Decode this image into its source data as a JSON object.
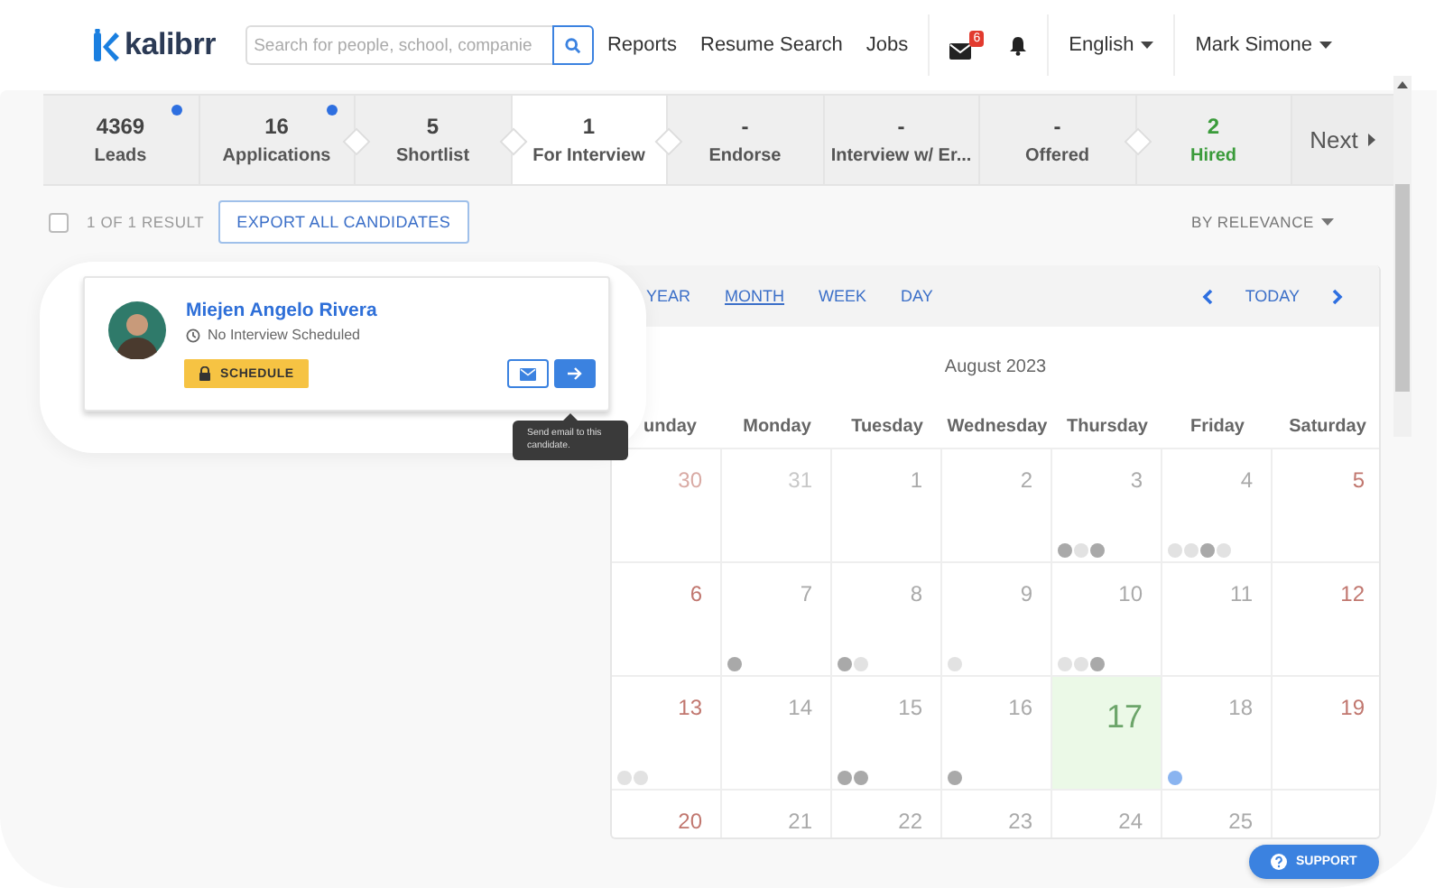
{
  "header": {
    "logo": "kalibrr",
    "search": {
      "placeholder": "Search for people, school, companie"
    },
    "nav": [
      "Reports",
      "Resume Search",
      "Jobs"
    ],
    "mail_badge": "6",
    "language": "English",
    "user": "Mark Simone"
  },
  "stages": [
    {
      "count": "4369",
      "label": "Leads",
      "notify": true,
      "selected": false,
      "kind": "stage",
      "arrow": false
    },
    {
      "count": "16",
      "label": "Applications",
      "notify": true,
      "selected": false,
      "kind": "stage",
      "arrow": true
    },
    {
      "count": "5",
      "label": "Shortlist",
      "notify": false,
      "selected": false,
      "kind": "stage",
      "arrow": true
    },
    {
      "count": "1",
      "label": "For Interview",
      "notify": false,
      "selected": true,
      "kind": "stage",
      "arrow": true
    },
    {
      "count": "-",
      "label": "Endorse",
      "notify": false,
      "selected": false,
      "kind": "stage",
      "arrow": false
    },
    {
      "count": "-",
      "label": "Interview w/ Er...",
      "notify": false,
      "selected": false,
      "kind": "stage",
      "arrow": false
    },
    {
      "count": "-",
      "label": "Offered",
      "notify": false,
      "selected": false,
      "kind": "stage",
      "arrow": true
    },
    {
      "count": "2",
      "label": "Hired",
      "notify": false,
      "selected": false,
      "kind": "hired",
      "arrow": false
    }
  ],
  "next": "Next",
  "results": {
    "checked": false,
    "count": "1 OF 1 RESULT",
    "export": "EXPORT ALL CANDIDATES",
    "sort": "BY RELEVANCE"
  },
  "candidate": {
    "name": "Miejen Angelo Rivera",
    "status": "No Interview Scheduled",
    "schedule": "SCHEDULE",
    "tooltip": "Send email to this candidate."
  },
  "calendar": {
    "views": [
      {
        "label": "YEAR",
        "selected": false
      },
      {
        "label": "MONTH",
        "selected": true
      },
      {
        "label": "WEEK",
        "selected": false
      },
      {
        "label": "DAY",
        "selected": false
      }
    ],
    "today": "TODAY",
    "title": "August 2023",
    "weekdays": [
      "unday",
      "Monday",
      "Tuesday",
      "Wednesday",
      "Thursday",
      "Friday",
      "Saturday"
    ],
    "weeks": [
      [
        {
          "day": "30",
          "muted": true,
          "today": false
        },
        {
          "day": "31",
          "muted": true,
          "today": false
        },
        {
          "day": "1",
          "muted": false,
          "today": false
        },
        {
          "day": "2",
          "muted": false,
          "today": false
        },
        {
          "day": "3",
          "muted": false,
          "today": false,
          "dots": [
            {
              "color": "#a9a9a9"
            },
            {
              "color": "#e2e2e2"
            },
            {
              "color": "#a9a9a9"
            }
          ]
        },
        {
          "day": "4",
          "muted": false,
          "today": false,
          "dots": [
            {
              "color": "#e2e2e2"
            },
            {
              "color": "#e2e2e2"
            },
            {
              "color": "#a9a9a9"
            },
            {
              "color": "#e2e2e2"
            }
          ]
        },
        {
          "day": "5",
          "muted": false,
          "today": false
        }
      ],
      [
        {
          "day": "6",
          "muted": false,
          "today": false
        },
        {
          "day": "7",
          "muted": false,
          "today": false,
          "dots": [
            {
              "color": "#a9a9a9"
            }
          ]
        },
        {
          "day": "8",
          "muted": false,
          "today": false,
          "dots": [
            {
              "color": "#a9a9a9"
            },
            {
              "color": "#e2e2e2"
            }
          ]
        },
        {
          "day": "9",
          "muted": false,
          "today": false,
          "dots": [
            {
              "color": "#e2e2e2"
            }
          ]
        },
        {
          "day": "10",
          "muted": false,
          "today": false,
          "dots": [
            {
              "color": "#e2e2e2"
            },
            {
              "color": "#e2e2e2"
            },
            {
              "color": "#a9a9a9"
            }
          ]
        },
        {
          "day": "11",
          "muted": false,
          "today": false
        },
        {
          "day": "12",
          "muted": false,
          "today": false
        }
      ],
      [
        {
          "day": "13",
          "muted": false,
          "today": false,
          "dots": [
            {
              "color": "#e2e2e2"
            },
            {
              "color": "#e2e2e2"
            }
          ]
        },
        {
          "day": "14",
          "muted": false,
          "today": false
        },
        {
          "day": "15",
          "muted": false,
          "today": false,
          "dots": [
            {
              "color": "#a9a9a9"
            },
            {
              "color": "#a9a9a9"
            }
          ]
        },
        {
          "day": "16",
          "muted": false,
          "today": false,
          "dots": [
            {
              "color": "#a9a9a9"
            }
          ]
        },
        {
          "day": "17",
          "muted": false,
          "today": true
        },
        {
          "day": "18",
          "muted": false,
          "today": false,
          "dots": [
            {
              "color": "#8ab4f0"
            }
          ]
        },
        {
          "day": "19",
          "muted": false,
          "today": false
        }
      ],
      [
        {
          "day": "20",
          "muted": false,
          "today": false
        },
        {
          "day": "21",
          "muted": false,
          "today": false
        },
        {
          "day": "22",
          "muted": false,
          "today": false
        },
        {
          "day": "23",
          "muted": false,
          "today": false
        },
        {
          "day": "24",
          "muted": false,
          "today": false
        },
        {
          "day": "25",
          "muted": false,
          "today": false
        }
      ]
    ]
  },
  "support": "SUPPORT"
}
